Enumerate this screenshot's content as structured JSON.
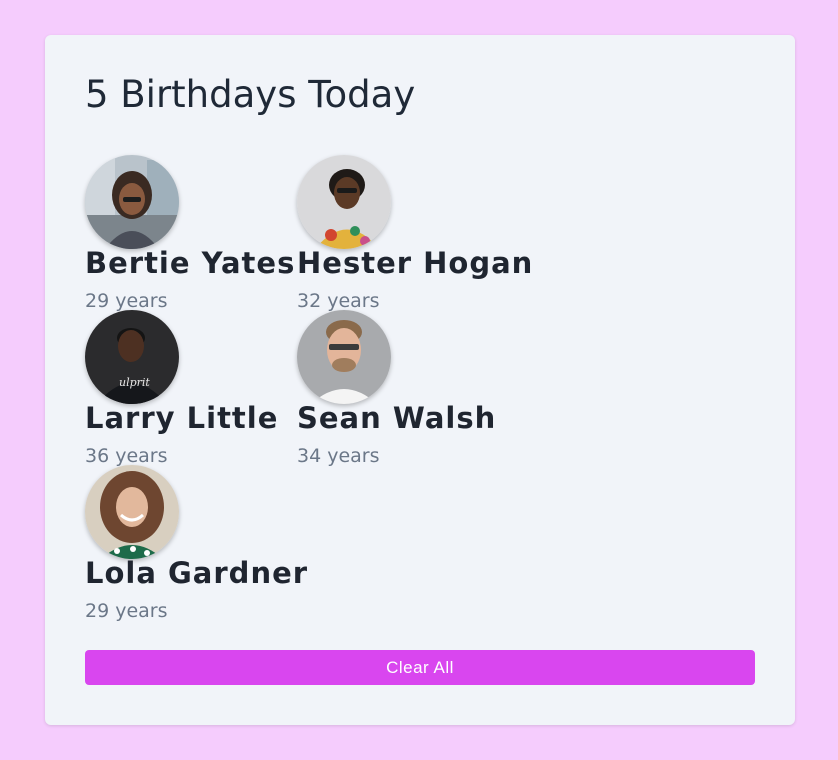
{
  "title": "5 Birthdays Today",
  "people": [
    {
      "name": "Bertie Yates",
      "age": "29 years",
      "avatar_icon": "woman-glasses-street-photo"
    },
    {
      "name": "Hester Hogan",
      "age": "32 years",
      "avatar_icon": "woman-floral-shirt-photo"
    },
    {
      "name": "Larry Little",
      "age": "36 years",
      "avatar_icon": "man-dark-tshirt-photo"
    },
    {
      "name": "Sean Walsh",
      "age": "34 years",
      "avatar_icon": "man-glasses-beard-photo"
    },
    {
      "name": "Lola Gardner",
      "age": "29 years",
      "avatar_icon": "woman-curly-hair-photo"
    }
  ],
  "clear_button_label": "Clear All",
  "colors": {
    "page_background": "#f5ccfd",
    "card_background": "#f1f4f9",
    "button_background": "#d946ef"
  }
}
